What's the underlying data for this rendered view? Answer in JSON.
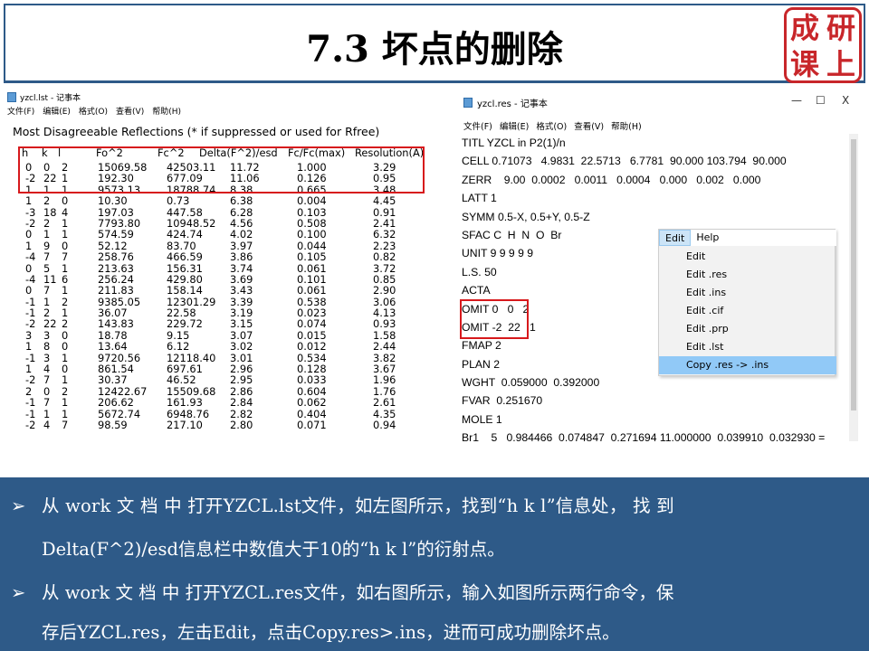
{
  "slide_title": "7.3 坏点的删除",
  "seal_chars": [
    "成",
    "研",
    "课",
    "上"
  ],
  "left_window": {
    "title": "yzcl.lst - 记事本",
    "menu": [
      "文件(F)",
      "编辑(E)",
      "格式(O)",
      "查看(V)",
      "帮助(H)"
    ],
    "heading": "Most Disagreeable Reflections (* if suppressed or used for Rfree)",
    "columns": [
      "h",
      "k",
      "l",
      "Fo^2",
      "Fc^2",
      "Delta(F^2)/esd",
      "Fc/Fc(max)",
      "Resolution(A)"
    ],
    "rows": [
      [
        "0",
        "0",
        "2",
        "15069.58",
        "42503.11",
        "11.72",
        "1.000",
        "3.29"
      ],
      [
        "-2",
        "22",
        "1",
        "192.30",
        "677.09",
        "11.06",
        "0.126",
        "0.95"
      ],
      [
        "1",
        "1",
        "1",
        "9573.13",
        "18788.74",
        "8.38",
        "0.665",
        "3.48"
      ],
      [
        "1",
        "2",
        "0",
        "10.30",
        "0.73",
        "6.38",
        "0.004",
        "4.45"
      ],
      [
        "-3",
        "18",
        "4",
        "197.03",
        "447.58",
        "6.28",
        "0.103",
        "0.91"
      ],
      [
        "-2",
        "2",
        "1",
        "7793.80",
        "10948.52",
        "4.56",
        "0.508",
        "2.41"
      ],
      [
        "0",
        "1",
        "1",
        "574.59",
        "424.74",
        "4.02",
        "0.100",
        "6.32"
      ],
      [
        "1",
        "9",
        "0",
        "52.12",
        "83.70",
        "3.97",
        "0.044",
        "2.23"
      ],
      [
        "-4",
        "7",
        "7",
        "258.76",
        "466.59",
        "3.86",
        "0.105",
        "0.82"
      ],
      [
        "0",
        "5",
        "1",
        "213.63",
        "156.31",
        "3.74",
        "0.061",
        "3.72"
      ],
      [
        "-4",
        "11",
        "6",
        "256.24",
        "429.80",
        "3.69",
        "0.101",
        "0.85"
      ],
      [
        "0",
        "7",
        "1",
        "211.83",
        "158.14",
        "3.43",
        "0.061",
        "2.90"
      ],
      [
        "-1",
        "1",
        "2",
        "9385.05",
        "12301.29",
        "3.39",
        "0.538",
        "3.06"
      ],
      [
        "-1",
        "2",
        "1",
        "36.07",
        "22.58",
        "3.19",
        "0.023",
        "4.13"
      ],
      [
        "-2",
        "22",
        "2",
        "143.83",
        "229.72",
        "3.15",
        "0.074",
        "0.93"
      ],
      [
        "3",
        "3",
        "0",
        "18.78",
        "9.15",
        "3.07",
        "0.015",
        "1.58"
      ],
      [
        "1",
        "8",
        "0",
        "13.64",
        "6.12",
        "3.02",
        "0.012",
        "2.44"
      ],
      [
        "-1",
        "3",
        "1",
        "9720.56",
        "12118.40",
        "3.01",
        "0.534",
        "3.82"
      ],
      [
        "1",
        "4",
        "0",
        "861.54",
        "697.61",
        "2.96",
        "0.128",
        "3.67"
      ],
      [
        "-2",
        "7",
        "1",
        "30.37",
        "46.52",
        "2.95",
        "0.033",
        "1.96"
      ],
      [
        "2",
        "0",
        "2",
        "12422.67",
        "15509.68",
        "2.86",
        "0.604",
        "1.76"
      ],
      [
        "-1",
        "7",
        "1",
        "206.62",
        "161.93",
        "2.84",
        "0.062",
        "2.61"
      ],
      [
        "-1",
        "1",
        "1",
        "5672.74",
        "6948.76",
        "2.82",
        "0.404",
        "4.35"
      ],
      [
        "-2",
        "4",
        "7",
        "98.59",
        "217.10",
        "2.80",
        "0.071",
        "0.94"
      ]
    ]
  },
  "right_window": {
    "title": "yzcl.res - 记事本",
    "controls": [
      "—",
      "☐",
      "X"
    ],
    "menu": [
      "文件(F)",
      "编辑(E)",
      "格式(O)",
      "查看(V)",
      "帮助(H)"
    ],
    "lines": [
      "TITL YZCL in P2(1)/n",
      "CELL 0.71073   4.9831  22.5713   6.7781  90.000 103.794  90.000",
      "ZERR    9.00  0.0002   0.0011   0.0004   0.000   0.002   0.000",
      "LATT 1",
      "SYMM 0.5-X, 0.5+Y, 0.5-Z",
      "SFAC C  H  N  O  Br",
      "UNIT 9 9 9 9 9",
      "L.S. 50",
      "ACTA",
      "OMIT 0   0   2",
      "OMIT -2  22   1",
      "FMAP 2",
      "PLAN 2",
      "WGHT  0.059000  0.392000",
      "FVAR  0.251670",
      "MOLE 1",
      "Br1    5   0.984466  0.074847  0.271694 11.000000  0.039910  0.032930 ="
    ]
  },
  "context_menu": {
    "menubar": [
      "Edit",
      "Help"
    ],
    "items": [
      "Edit",
      "Edit .res",
      "Edit .ins",
      "Edit .cif",
      "Edit .prp",
      "Edit .lst",
      "Copy .res -> .ins"
    ],
    "highlighted_index": 6
  },
  "bullets": {
    "b1_line1": "从 work 文 档 中 打开YZCL.lst文件，如左图所示，找到“h   k   l”信息处，  找 到",
    "b1_line2": "Delta(F^2)/esd信息栏中数值大于10的“h k l”的衍射点。",
    "b2_line1": "从 work 文 档 中 打开YZCL.res文件，如右图所示，输入如图所示两行命令，保",
    "b2_line2": "存后YZCL.res，左击Edit，点击Copy.res>.ins，进而可成功删除坏点。",
    "bullet_symbol": "➢"
  },
  "colors": {
    "accent_blue": "#2e5a88",
    "highlight_red": "#d7191c",
    "menu_highlight": "#91c9f7"
  }
}
